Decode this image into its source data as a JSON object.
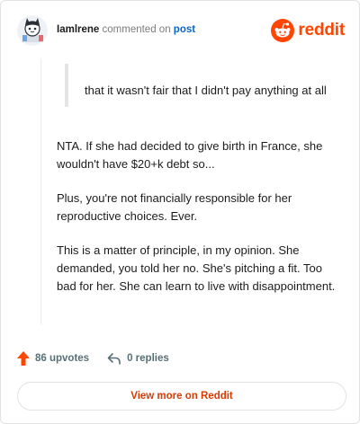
{
  "header": {
    "username": "Iamlrene",
    "action_text": "commented on",
    "post_link": "post",
    "logo_text": "reddit"
  },
  "comment": {
    "quote": "that it wasn't fair that I didn't pay anything at all",
    "paragraphs": [
      "NTA. If she had decided to give birth in France, she wouldn't have $20+k debt so...",
      "Plus, you're not financially responsible for her reproductive choices. Ever.",
      "This is a matter of principle, in my opinion. She demanded, you told her no. She's pitching a fit. Too bad for her. She can learn to live with disappointment."
    ]
  },
  "footer": {
    "upvotes": "86 upvotes",
    "replies": "0 replies",
    "view_more": "View more on Reddit"
  },
  "colors": {
    "brand": "#ff4500",
    "link": "#0a66c2",
    "button_text": "#d93a00"
  },
  "icons": [
    "avatar",
    "reddit-logo-icon",
    "upvote-arrow-icon",
    "reply-icon"
  ]
}
